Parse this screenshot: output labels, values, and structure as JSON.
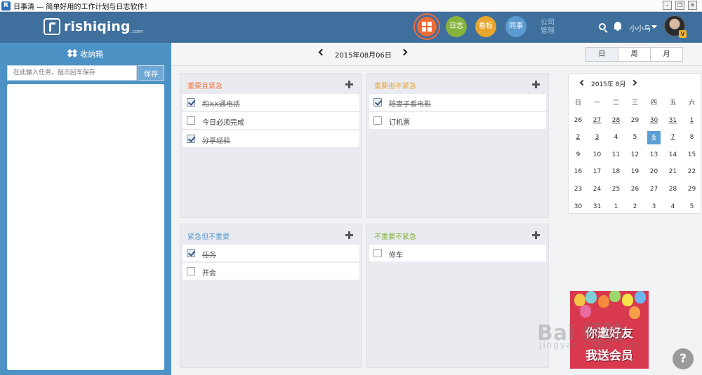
{
  "window": {
    "title": "日事清 — 简单好用的工作计划与日志软件！",
    "app_icon": "R"
  },
  "header": {
    "logo_text": "rishiqing",
    "logo_suffix": ".com",
    "nav": {
      "log": "日志",
      "board": "看板",
      "colleague": "同事",
      "company": "公司管理"
    },
    "user_name": "小小鸟",
    "vip_badge": "V",
    "colors": {
      "bar": "#3f6f9c",
      "home": "#ee6b35",
      "log": "#86b33c",
      "board": "#e7a62d",
      "colleague": "#5b9bd0"
    }
  },
  "sidebar": {
    "title": "收纳箱",
    "input_placeholder": "在此输入任务，敲击回车保存",
    "save_label": "保存"
  },
  "datebar": {
    "date": "2015年08月06日",
    "views": [
      "日",
      "周",
      "月"
    ],
    "active_view": "日"
  },
  "quadrants": [
    {
      "title": "重要且紧急",
      "color": "#f07a4a",
      "items": [
        {
          "text": "和XX通电话",
          "done": true
        },
        {
          "text": "今日必须完成",
          "done": false
        },
        {
          "text": "分享经验",
          "done": true
        }
      ]
    },
    {
      "title": "重要但不紧急",
      "color": "#e8a63a",
      "items": [
        {
          "text": "陪妻子看电影",
          "done": true
        },
        {
          "text": "订机票",
          "done": false
        }
      ]
    },
    {
      "title": "紧急但不重要",
      "color": "#5b9bd0",
      "items": [
        {
          "text": "任务",
          "done": true
        },
        {
          "text": "开会",
          "done": false
        }
      ]
    },
    {
      "title": "不重要不紧急",
      "color": "#86b33c",
      "items": [
        {
          "text": "修车",
          "done": false
        }
      ]
    }
  ],
  "calendar": {
    "month_label": "2015年 8月",
    "weekdays": [
      "日",
      "一",
      "二",
      "三",
      "四",
      "五",
      "六"
    ],
    "days": [
      [
        {
          "d": "26"
        },
        {
          "d": "27",
          "u": true
        },
        {
          "d": "28",
          "u": true
        },
        {
          "d": "29"
        },
        {
          "d": "30",
          "u": true
        },
        {
          "d": "31",
          "u": true
        },
        {
          "d": "1",
          "u": true
        }
      ],
      [
        {
          "d": "2",
          "u": true
        },
        {
          "d": "3",
          "u": true
        },
        {
          "d": "4"
        },
        {
          "d": "5"
        },
        {
          "d": "6",
          "u": true,
          "today": true
        },
        {
          "d": "7",
          "u": true
        },
        {
          "d": "8"
        }
      ],
      [
        {
          "d": "9"
        },
        {
          "d": "10"
        },
        {
          "d": "11"
        },
        {
          "d": "12"
        },
        {
          "d": "13"
        },
        {
          "d": "14"
        },
        {
          "d": "15"
        }
      ],
      [
        {
          "d": "16"
        },
        {
          "d": "17"
        },
        {
          "d": "18"
        },
        {
          "d": "19"
        },
        {
          "d": "20"
        },
        {
          "d": "21"
        },
        {
          "d": "22"
        }
      ],
      [
        {
          "d": "23"
        },
        {
          "d": "24"
        },
        {
          "d": "25"
        },
        {
          "d": "26"
        },
        {
          "d": "27"
        },
        {
          "d": "28"
        },
        {
          "d": "29"
        }
      ],
      [
        {
          "d": "30"
        },
        {
          "d": "31"
        },
        {
          "d": "1"
        },
        {
          "d": "2"
        },
        {
          "d": "3"
        },
        {
          "d": "4"
        },
        {
          "d": "5"
        }
      ]
    ]
  },
  "promo": {
    "line1": "你邀好友",
    "line2": "我送会员"
  },
  "help_label": "?",
  "watermark": {
    "text": "Bai 经验",
    "sub": "jingyan.baidu.com"
  }
}
